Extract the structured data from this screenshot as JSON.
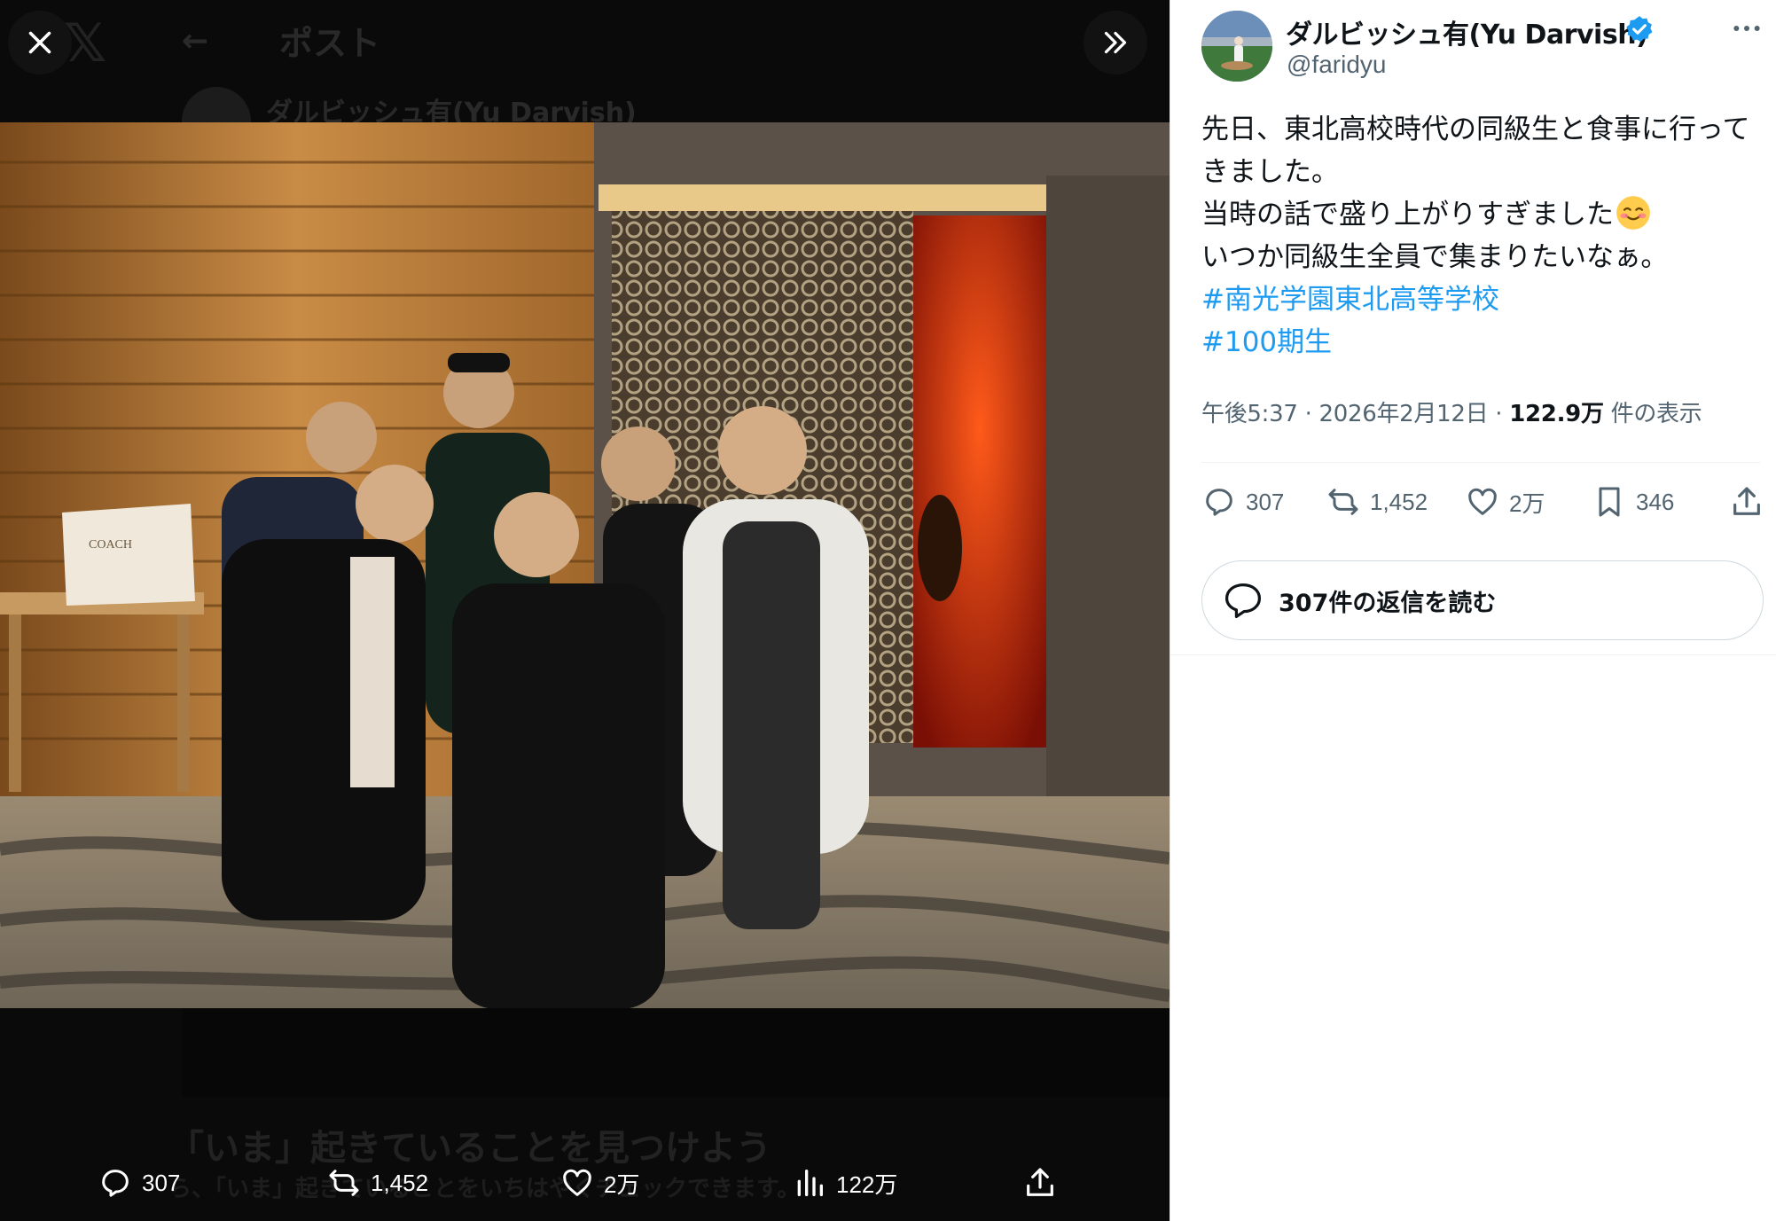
{
  "viewer": {
    "ghost_title": "ポスト",
    "ghost_author": "ダルビッシュ有(Yu Darvish)",
    "ghost_cta": "「いま」起きていることを見つけよう",
    "ghost_cta_sub": "ら、「いま」起きていることをいちはやくチェックできます。",
    "actions": {
      "reply_count": "307",
      "repost_count": "1,452",
      "like_count": "2万",
      "views_count": "122万"
    }
  },
  "panel": {
    "display_name": "ダルビッシュ有(Yu Darvish)",
    "handle": "@faridyu",
    "tweet": {
      "line1": "先日、東北高校時代の同級生と食事に行って",
      "line2": "きました。",
      "line3": "当時の話で盛り上がりすぎました",
      "line4": "いつか同級生全員で集まりたいなぁ。",
      "hashtag1": "#南光学園東北高等学校",
      "hashtag2": "#100期生"
    },
    "meta": {
      "time": "午後5:37",
      "separator": "·",
      "date": "2026年2月12日",
      "views": "122.9万",
      "views_label": "件の表示"
    },
    "actions": {
      "reply_count": "307",
      "repost_count": "1,452",
      "like_count": "2万",
      "bookmark_count": "346"
    },
    "replies_button": "307件の返信を読む"
  },
  "colors": {
    "accent": "#1d9bf0",
    "text_primary": "#0f1419",
    "text_secondary": "#536471",
    "viewer_bg": "#0a0a0a"
  },
  "icons": [
    "close-icon",
    "double-chevron-right-icon",
    "reply-icon",
    "repost-icon",
    "like-icon",
    "views-icon",
    "share-icon",
    "bookmark-icon",
    "verified-icon",
    "more-icon",
    "back-arrow-icon"
  ]
}
